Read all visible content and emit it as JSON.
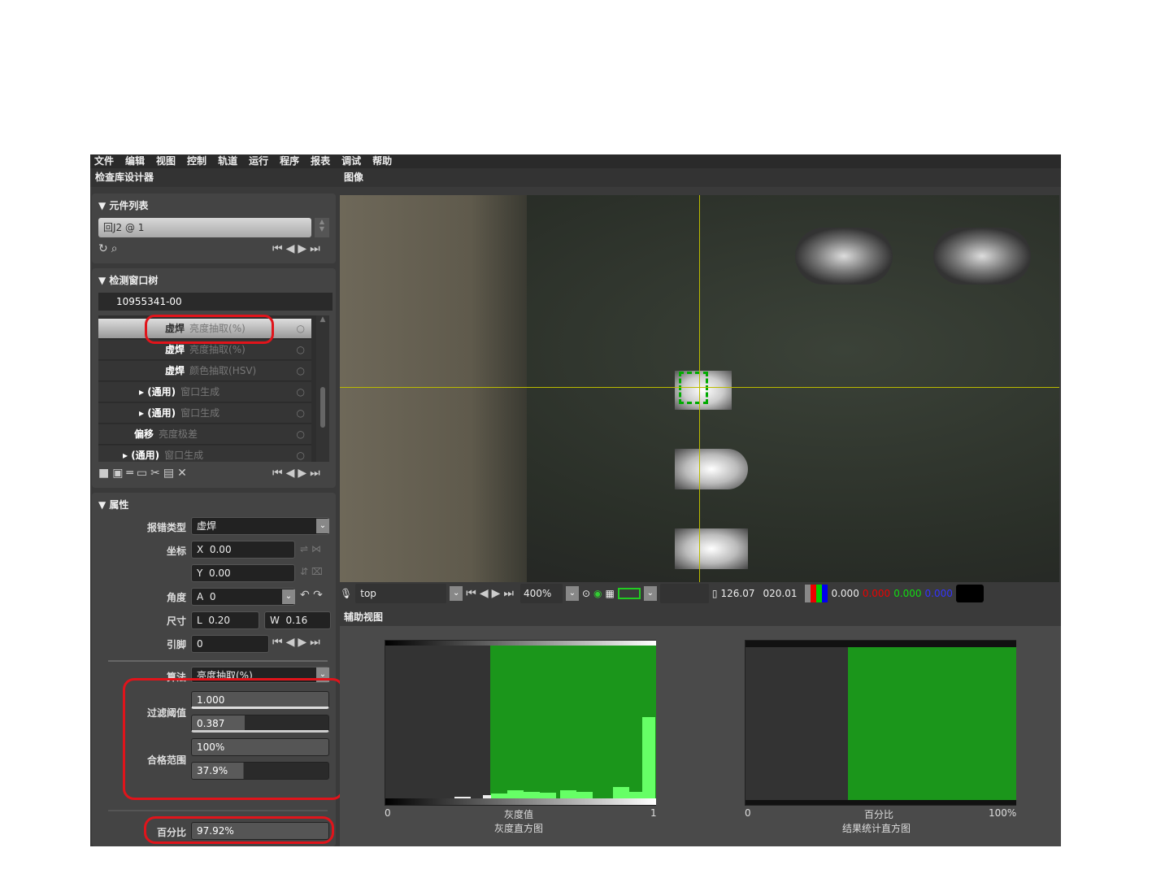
{
  "menu": [
    "文件",
    "编辑",
    "视图",
    "控制",
    "轨道",
    "运行",
    "程序",
    "报表",
    "调试",
    "帮助"
  ],
  "titles": {
    "designer": "检查库设计器",
    "image": "图像",
    "aux": "辅助视图"
  },
  "component_list": {
    "header": "▼ 元件列表",
    "value": "回J2 @ 1"
  },
  "window_tree": {
    "header": "▼ 检测窗口树",
    "id": "10955341-00",
    "rows": [
      {
        "name": "虚焊",
        "algo": "亮度抽取(%)"
      },
      {
        "name": "虚焊",
        "algo": "亮度抽取(%)"
      },
      {
        "name": "虚焊",
        "algo": "颜色抽取(HSV)"
      },
      {
        "name": "▸ (通用)",
        "algo": "窗口生成"
      },
      {
        "name": "▸ (通用)",
        "algo": "窗口生成"
      },
      {
        "name": "偏移",
        "algo": "亮度极差"
      },
      {
        "name": "▸ (通用)",
        "algo": "窗口生成"
      }
    ]
  },
  "properties": {
    "header": "▼ 属性",
    "defect_type_label": "报错类型",
    "defect_type": "虚焊",
    "coord_label": "坐标",
    "x": "0.00",
    "y": "0.00",
    "angle_label": "角度",
    "angle": "0",
    "size_label": "尺寸",
    "l": "0.20",
    "w": "0.16",
    "pin_label": "引脚",
    "pin": "0",
    "algo_label": "算法",
    "algo": "亮度抽取(%)",
    "filter_label": "过滤阈值",
    "filter_hi": "1.000",
    "filter_lo": "0.387",
    "pass_label": "合格范围",
    "pass_hi": "100%",
    "pass_lo": "37.9%",
    "pct_label": "百分比",
    "pct": "97.92%"
  },
  "toolbar": {
    "view": "top",
    "zoom": "400%",
    "coord_x": "126.07",
    "coord_y": "020.01",
    "gray": "0.000",
    "r": "0.000",
    "g": "0.000",
    "b": "0.000"
  },
  "hist1": {
    "min": "0",
    "max": "1",
    "xlabel": "灰度值",
    "title": "灰度直方图",
    "threshold_lo": 0.387,
    "threshold_hi": 1.0
  },
  "hist2": {
    "min": "0",
    "max": "100%",
    "xlabel": "百分比",
    "title": "结果统计直方图",
    "value_pct": 37.9
  }
}
